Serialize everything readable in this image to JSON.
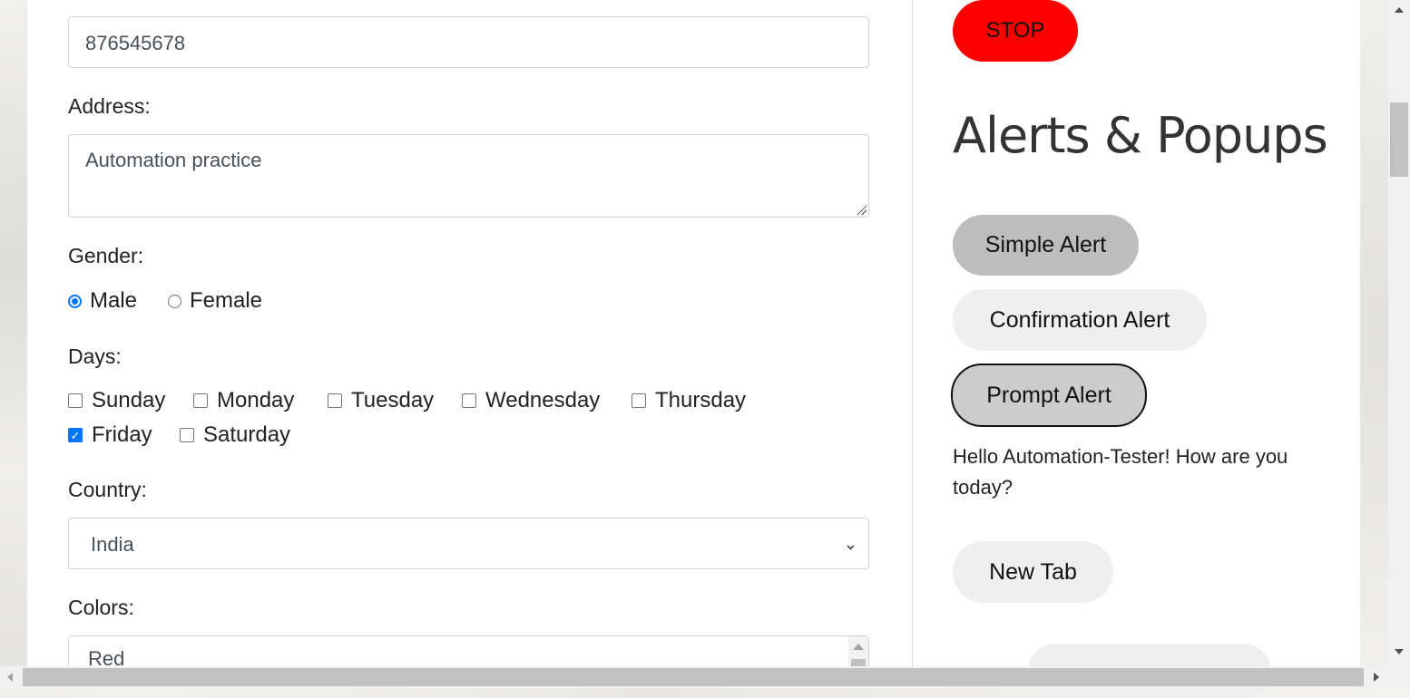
{
  "form": {
    "phone_value": "876545678",
    "address_label": "Address:",
    "address_value": "Automation practice",
    "gender_label": "Gender:",
    "gender_options": [
      {
        "label": "Male",
        "selected": true
      },
      {
        "label": "Female",
        "selected": false
      }
    ],
    "days_label": "Days:",
    "days": [
      {
        "label": "Sunday",
        "checked": false
      },
      {
        "label": "Monday",
        "checked": false
      },
      {
        "label": "Tuesday",
        "checked": false
      },
      {
        "label": "Wednesday",
        "checked": false
      },
      {
        "label": "Thursday",
        "checked": false
      },
      {
        "label": "Friday",
        "checked": true
      },
      {
        "label": "Saturday",
        "checked": false
      }
    ],
    "country_label": "Country:",
    "country_value": "India",
    "colors_label": "Colors:",
    "colors_first_item": "Red"
  },
  "side": {
    "stop_label": "STOP",
    "stop_color": "#ff0000",
    "heading": "Alerts & Popups",
    "simple_alert_label": "Simple Alert",
    "confirm_alert_label": "Confirmation Alert",
    "prompt_alert_label": "Prompt Alert",
    "prompt_result_text": "Hello Automation-Tester! How are you today?",
    "new_tab_label": "New Tab"
  },
  "icons": {
    "select_chevron": "chevron-down-icon",
    "checkmark": "checkmark-icon"
  }
}
